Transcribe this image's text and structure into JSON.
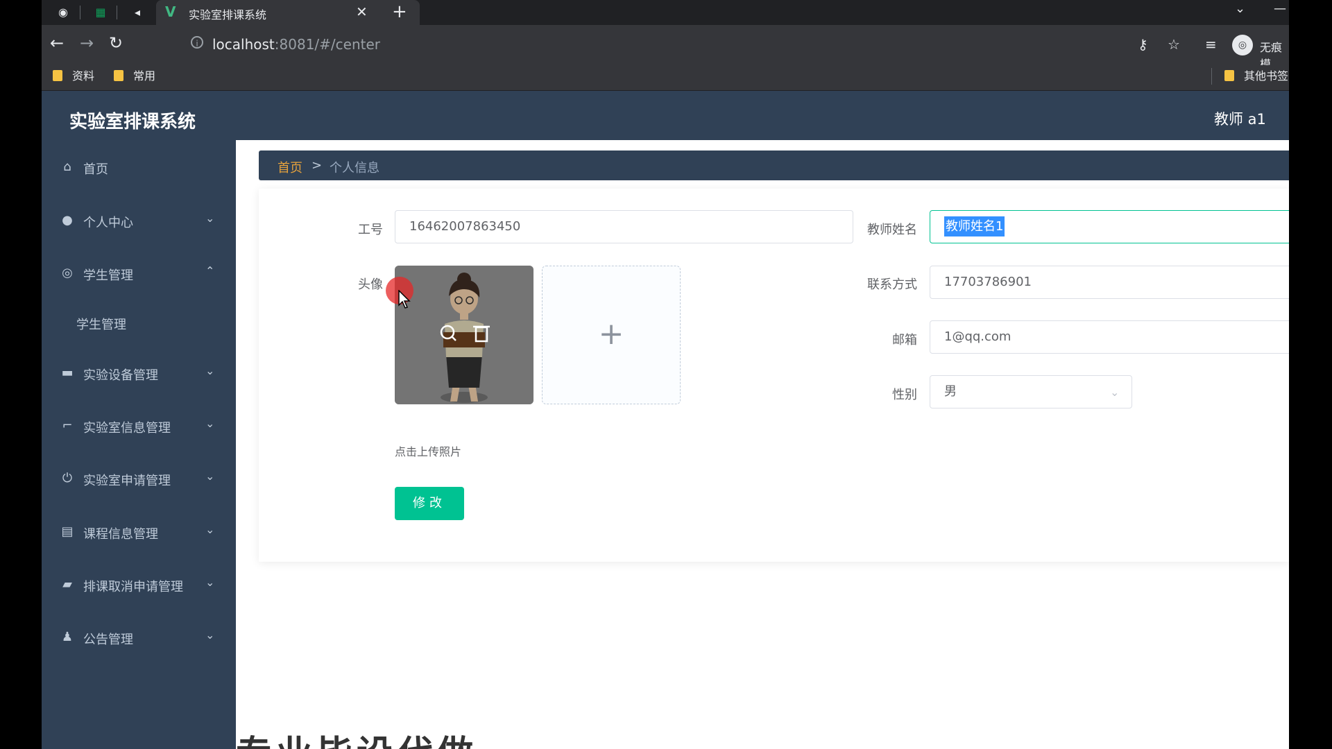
{
  "browser": {
    "tab_title": "实验室排课系统",
    "url_host": "localhost",
    "url_rest": ":8081/#/center",
    "profile_name": "无痕模",
    "bookmarks": [
      "资料",
      "常用"
    ],
    "other_bookmarks": "其他书签"
  },
  "app": {
    "title": "实验室排课系统",
    "user": "教师 a1"
  },
  "sidebar": {
    "items": [
      {
        "label": "首页",
        "icon": "home-icon"
      },
      {
        "label": "个人中心",
        "icon": "user-icon",
        "arrow": "down"
      },
      {
        "label": "学生管理",
        "icon": "student-icon",
        "arrow": "up"
      },
      {
        "label": "学生管理",
        "sub": true
      },
      {
        "label": "实验设备管理",
        "icon": "equipment-icon",
        "arrow": "down"
      },
      {
        "label": "实验室信息管理",
        "icon": "lab-icon",
        "arrow": "down"
      },
      {
        "label": "实验室申请管理",
        "icon": "power-icon",
        "arrow": "down"
      },
      {
        "label": "课程信息管理",
        "icon": "briefcase-icon",
        "arrow": "down"
      },
      {
        "label": "排课取消申请管理",
        "icon": "chat-icon",
        "arrow": "down"
      },
      {
        "label": "公告管理",
        "icon": "notice-icon",
        "arrow": "down"
      }
    ]
  },
  "breadcrumb": {
    "home": "首页",
    "sep": ">",
    "current": "个人信息"
  },
  "form": {
    "id_label": "工号",
    "id_value": "16462007863450",
    "name_label": "教师姓名",
    "name_value": "教师姓名1",
    "avatar_label": "头像",
    "phone_label": "联系方式",
    "phone_value": "17703786901",
    "email_label": "邮箱",
    "email_value": "1@qq.com",
    "gender_label": "性别",
    "gender_value": "男",
    "upload_tip": "点击上传照片",
    "submit_label": "修改"
  },
  "caption": "专业毕设代做"
}
